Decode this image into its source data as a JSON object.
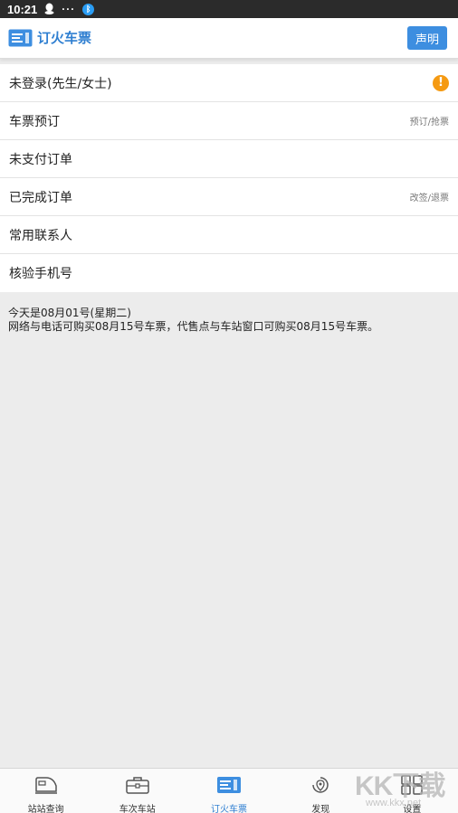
{
  "status_bar": {
    "time": "10:21",
    "icons": [
      "qq-icon",
      "more-dots-icon",
      "bluetooth-icon"
    ]
  },
  "header": {
    "title": "订火车票",
    "statement_label": "声明",
    "accent_color": "#2f7fd1"
  },
  "menu": {
    "items": [
      {
        "label": "未登录(先生/女士)",
        "hint": "",
        "icon": "warning-icon"
      },
      {
        "label": "车票预订",
        "hint": "预订/抢票"
      },
      {
        "label": "未支付订单",
        "hint": ""
      },
      {
        "label": "已完成订单",
        "hint": "改签/退票"
      },
      {
        "label": "常用联系人",
        "hint": ""
      },
      {
        "label": "核验手机号",
        "hint": ""
      }
    ]
  },
  "notice": {
    "line1": "今天是08月01号(星期二)",
    "line2": "网络与电话可购买08月15号车票，代售点与车站窗口可购买08月15号车票。"
  },
  "bottom_nav": {
    "tabs": [
      {
        "label": "站站查询",
        "icon": "train-icon"
      },
      {
        "label": "车次车站",
        "icon": "briefcase-icon"
      },
      {
        "label": "订火车票",
        "icon": "ticket-icon",
        "active": true
      },
      {
        "label": "发现",
        "icon": "discover-icon"
      },
      {
        "label": "设置",
        "icon": "grid-icon"
      }
    ]
  },
  "watermark": {
    "big": "KK下载",
    "small": "www.kkx.net"
  }
}
